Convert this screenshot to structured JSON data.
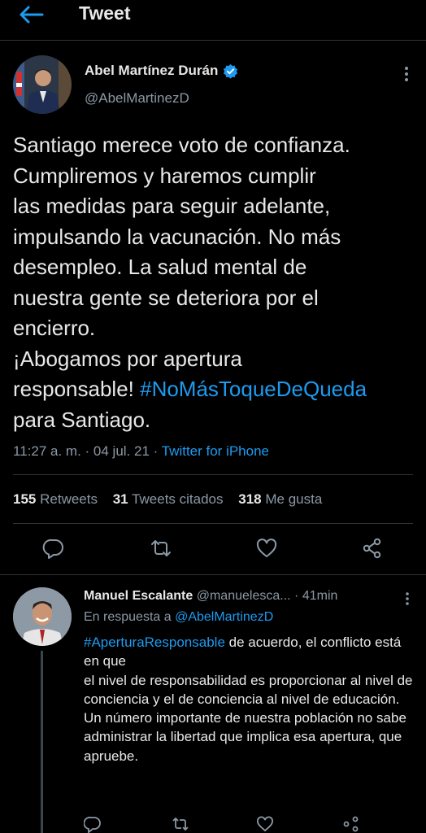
{
  "header": {
    "title": "Tweet"
  },
  "tweet": {
    "author_name": "Abel Martínez Durán",
    "author_handle": "@AbelMartinezD",
    "text_lines": [
      "Santiago merece voto de confianza.",
      "Cumpliremos y haremos cumplir",
      "las medidas para seguir adelante,",
      "impulsando la vacunación. No más",
      "desempleo. La salud mental de",
      "nuestra gente se deteriora por el",
      "encierro.",
      "¡Abogamos por apertura"
    ],
    "text_line9_prefix": "responsable! ",
    "hashtag": "#NoMásToqueDeQueda",
    "text_line10": "para Santiago.",
    "time": "11:27 a. m.",
    "date": "04 jul. 21",
    "separator": " · ",
    "source": "Twitter for iPhone",
    "stats": {
      "retweets_count": "155",
      "retweets_label": "Retweets",
      "quotes_count": "31",
      "quotes_label": "Tweets citados",
      "likes_count": "318",
      "likes_label": "Me gusta"
    }
  },
  "reply": {
    "author_name": "Manuel Escalante",
    "author_handle": "@manuelesca...",
    "time": "41min",
    "in_reply_prefix": "En respuesta a ",
    "in_reply_mention": "@AbelMartinezD",
    "hashtag": "#AperturaResponsable",
    "text_after_hashtag": " de acuerdo, el conflicto está en que",
    "text_rest": "el nivel de responsabilidad es proporcionar al nivel de conciencia y el de conciencia al nivel de educación. Un número importante de nuestra población no sabe administrar la libertad que implica esa apertura, que apruebe."
  },
  "colors": {
    "background": "#000000",
    "accent": "#1d9bf0",
    "secondary_text": "#8b98a5",
    "primary_text": "#e8e8e8"
  },
  "icons": {
    "back": "arrow-left-icon",
    "verified": "verified-badge-icon",
    "more": "more-vertical-icon",
    "reply": "comment-icon",
    "retweet": "retweet-icon",
    "like": "heart-icon",
    "share": "share-icon"
  }
}
